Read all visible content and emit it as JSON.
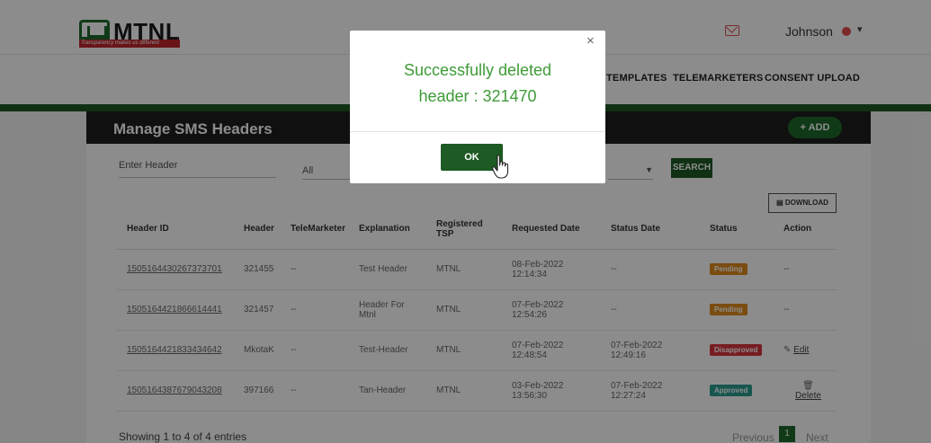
{
  "brand": {
    "name": "MTNL",
    "tagline": "Transparency makes us different"
  },
  "user": {
    "name": "Johnson"
  },
  "nav": [
    "TEMPLATES",
    "TELEMARKETERS",
    "CONSENT UPLOAD"
  ],
  "panel": {
    "title": "Manage SMS Headers",
    "add_label": "+ ADD",
    "filter_header_placeholder": "Enter Header",
    "filter_select_value": "All",
    "search_label": "SEARCH",
    "download_label": "DOWNLOAD"
  },
  "table": {
    "columns": [
      "Header ID",
      "Header",
      "TeleMarketer",
      "Explanation",
      "Registered TSP",
      "Requested Date",
      "Status Date",
      "Status",
      "Action"
    ],
    "rows": [
      {
        "id": "1505164430267373701",
        "header": "321455",
        "telemarketer": "--",
        "explanation": "Test Header",
        "tsp": "MTNL",
        "req_date": "08-Feb-2022",
        "req_time": "12:14:34",
        "status_date": "--",
        "status_time": "",
        "status": "Pending",
        "action": "--"
      },
      {
        "id": "1505164421866614441",
        "header": "321457",
        "telemarketer": "--",
        "explanation": "Header For Mtnl",
        "tsp": "MTNL",
        "req_date": "07-Feb-2022",
        "req_time": "12:54:26",
        "status_date": "--",
        "status_time": "",
        "status": "Pending",
        "action": "--"
      },
      {
        "id": "1505164421833434642",
        "header": "MkotaK",
        "telemarketer": "--",
        "explanation": "Test-Header",
        "tsp": "MTNL",
        "req_date": "07-Feb-2022",
        "req_time": "12:48:54",
        "status_date": "07-Feb-2022",
        "status_time": "12:49:16",
        "status": "Disapproved",
        "action": "Edit"
      },
      {
        "id": "1505164387679043208",
        "header": "397166",
        "telemarketer": "--",
        "explanation": "Tan-Header",
        "tsp": "MTNL",
        "req_date": "03-Feb-2022",
        "req_time": "13:56:30",
        "status_date": "07-Feb-2022",
        "status_time": "12:27:24",
        "status": "Approved",
        "action": "Delete"
      }
    ]
  },
  "footer": {
    "entries_text": "Showing 1 to 4 of 4 entries",
    "prev": "Previous",
    "current_page": "1",
    "next": "Next"
  },
  "modal": {
    "close": "×",
    "message_line1": "Successfully deleted",
    "message_line2": "header : 321470",
    "ok_label": "OK"
  },
  "colors": {
    "brand_green": "#1e6b2b",
    "pending": "#e08a1e",
    "disapproved": "#d9363e",
    "approved": "#2a9d8f",
    "success_text": "#3e9b36"
  }
}
